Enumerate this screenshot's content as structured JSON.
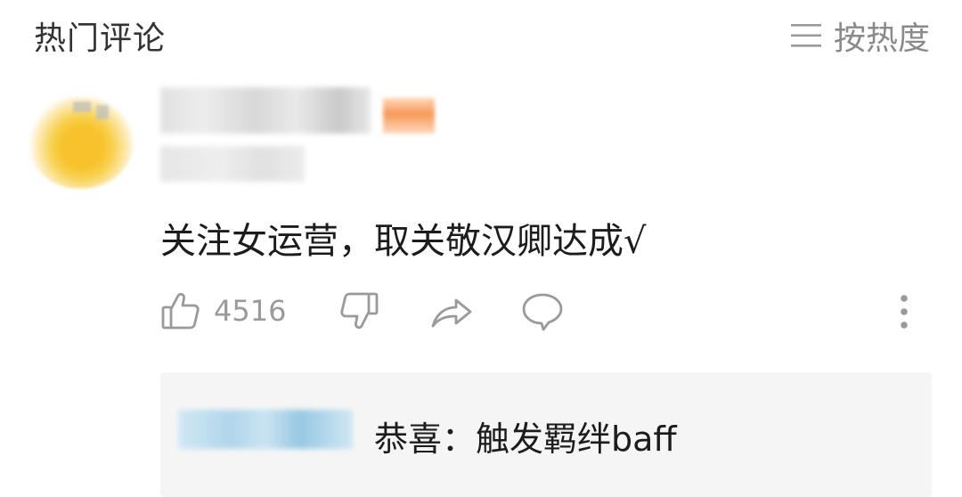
{
  "header": {
    "title": "热门评论",
    "sort_label": "按热度"
  },
  "comment": {
    "text": "关注女运营，取关敬汉卿达成√",
    "like_count": "4516"
  },
  "sub_comment": {
    "text": "恭喜：触发羁绊baff"
  },
  "colors": {
    "icon_gray": "#9a9a9a",
    "avatar_yellow": "#f7c22b",
    "badge_orange": "#f79a5a",
    "subuser_blue": "#a9d3ea",
    "sub_bg": "#f5f5f5"
  },
  "icons": [
    "menu-icon",
    "thumbs-up-icon",
    "thumbs-down-icon",
    "share-icon",
    "comment-icon",
    "more-vertical-icon"
  ]
}
